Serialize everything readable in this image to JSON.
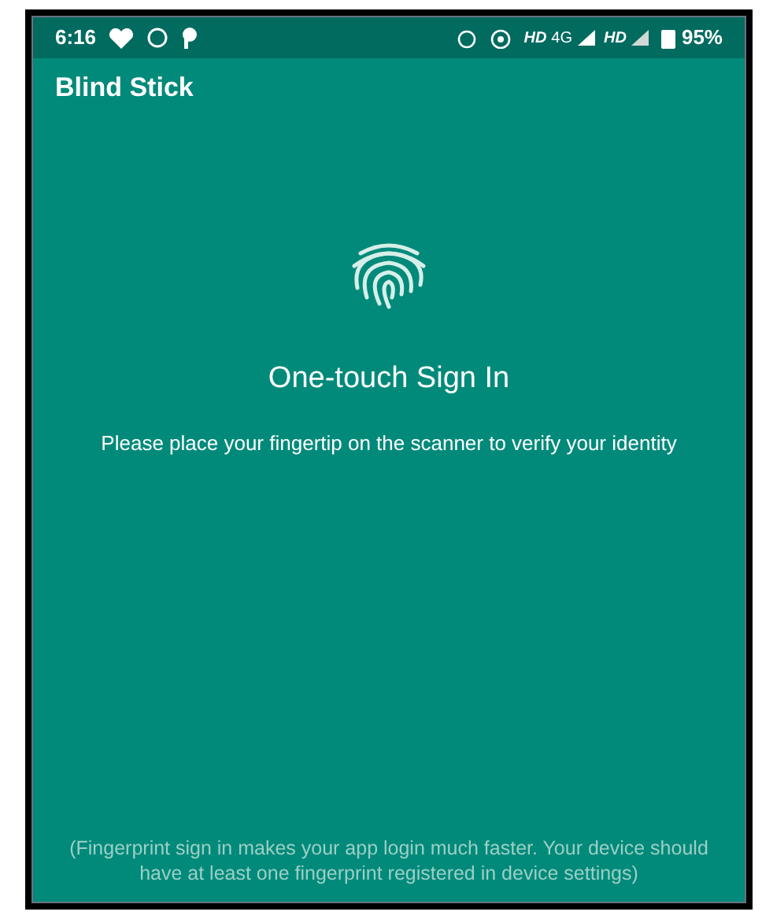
{
  "status_bar": {
    "time": "6:16",
    "network_1": "HD",
    "network_2": "4G",
    "network_3": "HD",
    "battery": "95%"
  },
  "app_bar": {
    "title": "Blind Stick"
  },
  "sign_in": {
    "title": "One-touch Sign In",
    "message": "Please place your fingertip on the scanner to verify your identity"
  },
  "footer_note": "(Fingerprint sign in makes your app login much faster. Your device should have at least one fingerprint registered in device settings)"
}
